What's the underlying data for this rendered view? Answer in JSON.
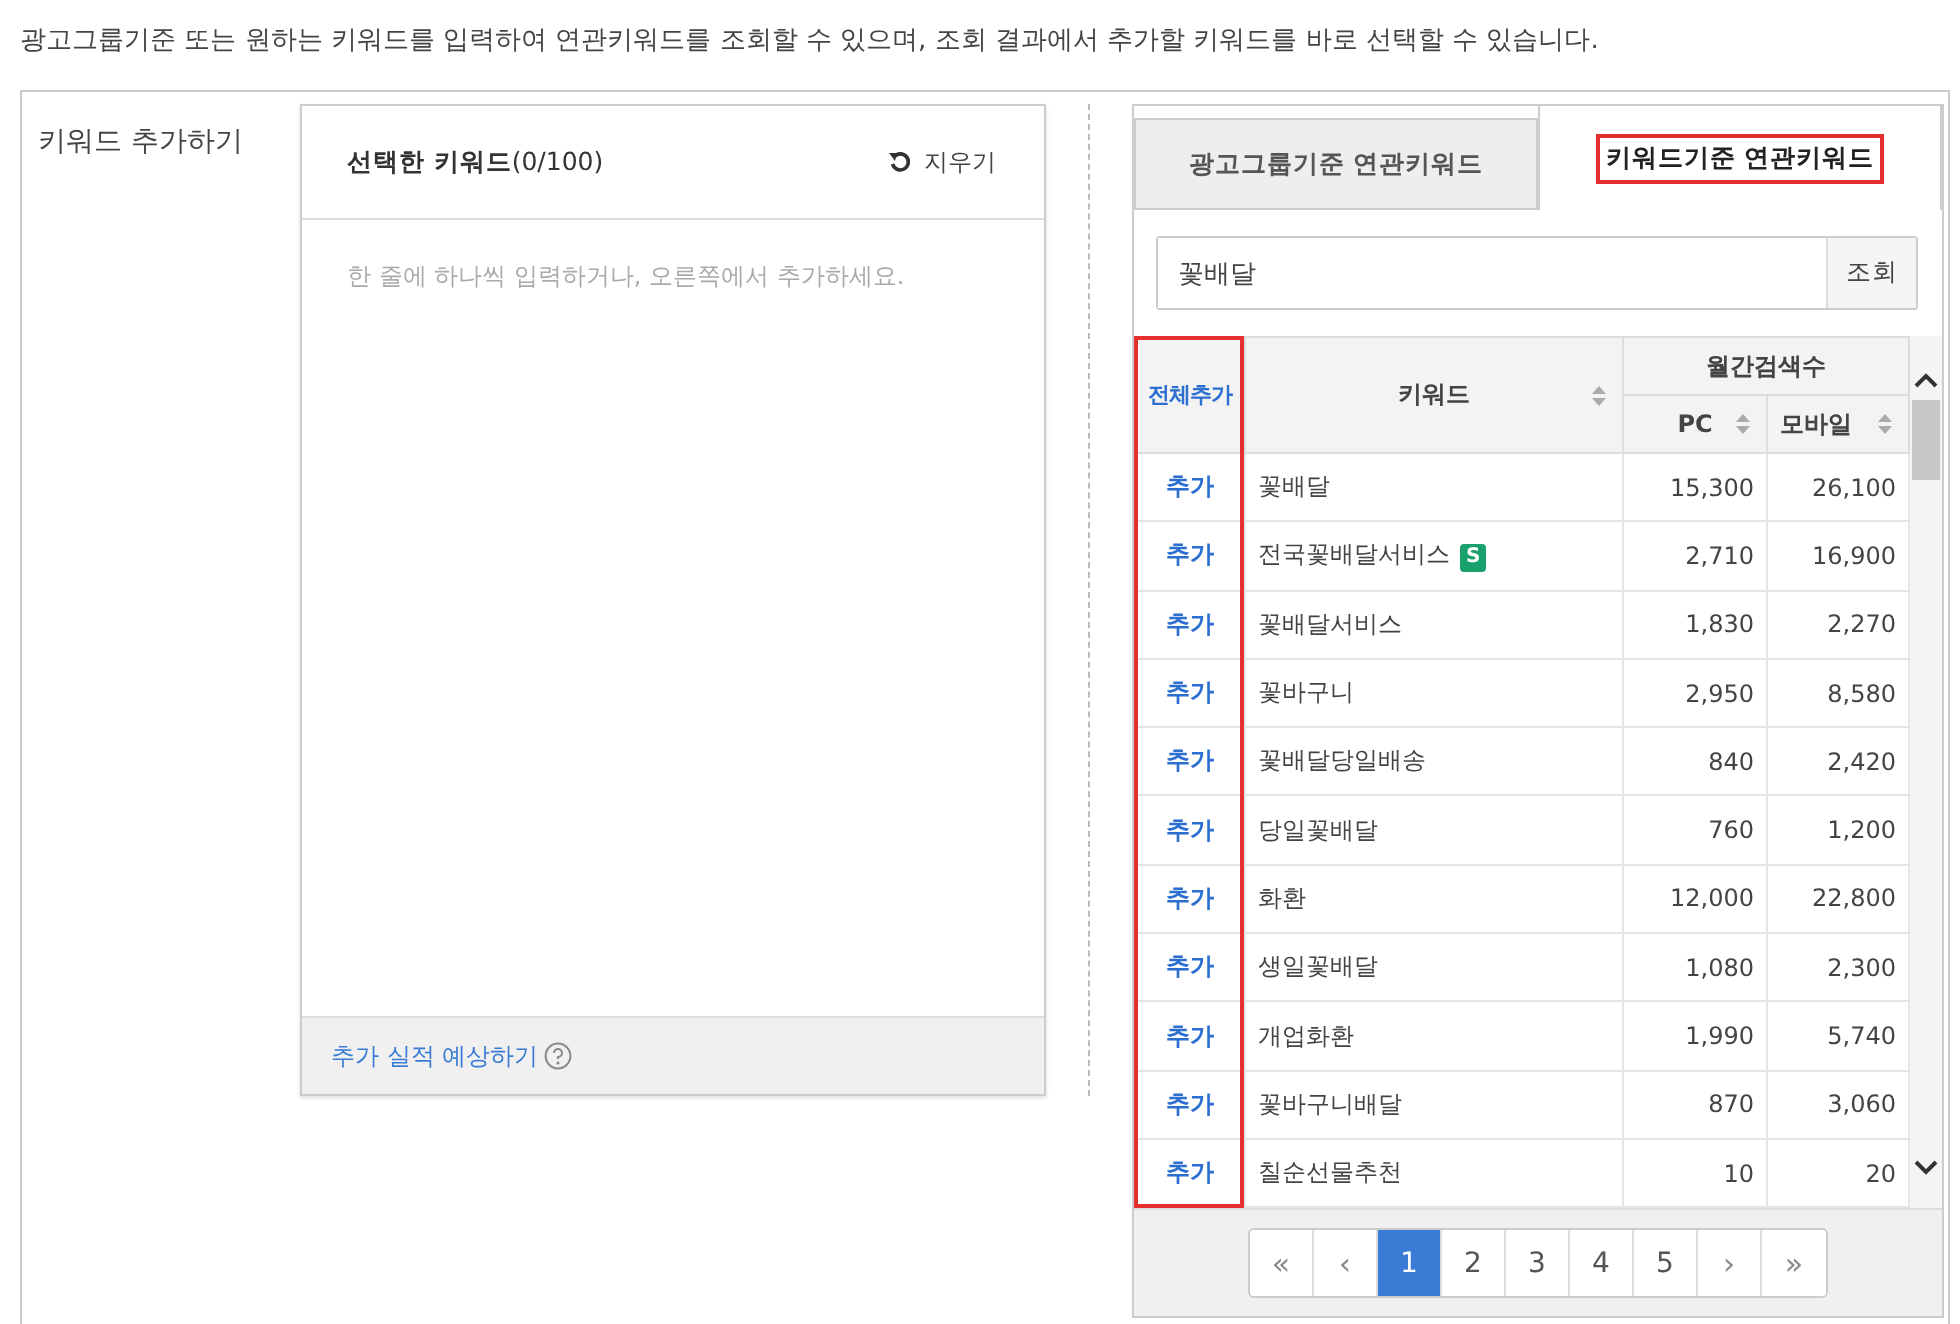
{
  "intro": "광고그룹기준 또는 원하는 키워드를 입력하여 연관키워드를 조회할 수 있으며, 조회 결과에서 추가할 키워드를 바로 선택할 수 있습니다.",
  "section_label": "키워드 추가하기",
  "selected_panel": {
    "title": "선택한 키워드",
    "count": "(0/100)",
    "clear_button": "지우기",
    "placeholder": "한 줄에 하나씩 입력하거나, 오른쪽에서 추가하세요.",
    "footer_link": "추가 실적 예상하기"
  },
  "tabs": [
    {
      "label": "광고그룹기준 연관키워드",
      "selected": false,
      "highlighted": false
    },
    {
      "label": "키워드기준 연관키워드",
      "selected": true,
      "highlighted": true
    }
  ],
  "search": {
    "value": "꽃배달",
    "button": "조회"
  },
  "table": {
    "add_all": "전체추가",
    "add_column_highlighted": true,
    "keyword_header": "키워드",
    "group_header": "월간검색수",
    "pc_header": "PC",
    "mobile_header": "모바일",
    "rows": [
      {
        "add": "추가",
        "keyword": "꽃배달",
        "pc": "15,300",
        "mobile": "26,100"
      },
      {
        "add": "추가",
        "keyword": "전국꽃배달서비스",
        "badge": "S",
        "pc": "2,710",
        "mobile": "16,900"
      },
      {
        "add": "추가",
        "keyword": "꽃배달서비스",
        "pc": "1,830",
        "mobile": "2,270"
      },
      {
        "add": "추가",
        "keyword": "꽃바구니",
        "pc": "2,950",
        "mobile": "8,580"
      },
      {
        "add": "추가",
        "keyword": "꽃배달당일배송",
        "pc": "840",
        "mobile": "2,420"
      },
      {
        "add": "추가",
        "keyword": "당일꽃배달",
        "pc": "760",
        "mobile": "1,200"
      },
      {
        "add": "추가",
        "keyword": "화환",
        "pc": "12,000",
        "mobile": "22,800"
      },
      {
        "add": "추가",
        "keyword": "생일꽃배달",
        "pc": "1,080",
        "mobile": "2,300"
      },
      {
        "add": "추가",
        "keyword": "개업화환",
        "pc": "1,990",
        "mobile": "5,740"
      },
      {
        "add": "추가",
        "keyword": "꽃바구니배달",
        "pc": "870",
        "mobile": "3,060"
      },
      {
        "add": "추가",
        "keyword": "칠순선물추천",
        "pc": "10",
        "mobile": "20"
      }
    ]
  },
  "pagination": [
    {
      "label": "«",
      "kind": "nav",
      "selected": false
    },
    {
      "label": "‹",
      "kind": "nav",
      "selected": false
    },
    {
      "label": "1",
      "kind": "page",
      "selected": true
    },
    {
      "label": "2",
      "kind": "page",
      "selected": false
    },
    {
      "label": "3",
      "kind": "page",
      "selected": false
    },
    {
      "label": "4",
      "kind": "page",
      "selected": false
    },
    {
      "label": "5",
      "kind": "page",
      "selected": false
    },
    {
      "label": "›",
      "kind": "nav",
      "selected": false
    },
    {
      "label": "»",
      "kind": "nav",
      "selected": false
    }
  ]
}
